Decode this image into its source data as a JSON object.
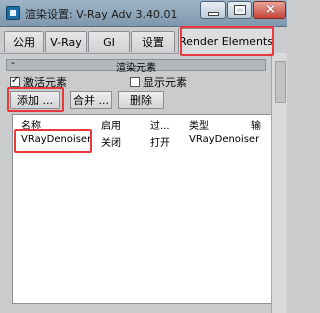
{
  "window": {
    "title": "渲染设置: V-Ray Adv 3.40.01",
    "close_glyph": "×"
  },
  "tabs": [
    "公用",
    "V-Ray",
    "GI",
    "设置",
    "Render Elements"
  ],
  "rollout": {
    "title": "渲染元素",
    "collapse_glyph": "-"
  },
  "checkboxes": {
    "active_label": "激活元素",
    "active_checked": true,
    "show_label": "显示元素",
    "show_checked": false,
    "check_glyph": "✓"
  },
  "buttons": {
    "add": "添加 ...",
    "merge": "合并 ...",
    "delete": "删除"
  },
  "list": {
    "columns": [
      "名称",
      "启用",
      "过...",
      "类型",
      "输"
    ],
    "rows": [
      {
        "name": "VRayDenoiser",
        "enabled": "关闭",
        "filter": "打开",
        "type": "VRayDenoiser"
      }
    ]
  },
  "colors": {
    "annotation": "#e8383d",
    "titlebar": "#8fa6bc"
  }
}
